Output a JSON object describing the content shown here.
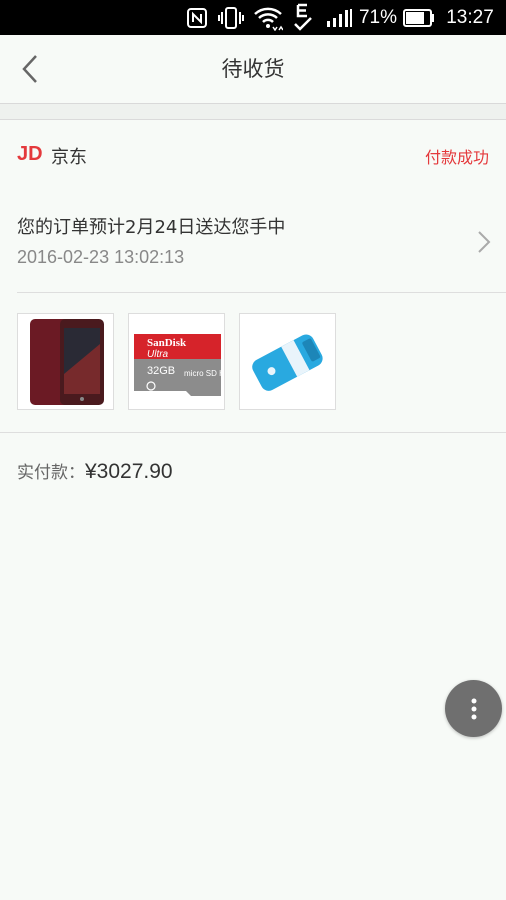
{
  "status_bar": {
    "battery_percent": "71%",
    "time": "13:27",
    "icons": [
      "nfc-icon",
      "vibrate-icon",
      "wifi-icon",
      "e-network-icon",
      "signal-icon",
      "battery-icon"
    ]
  },
  "header": {
    "title": "待收货",
    "back_icon": "chevron-left-icon"
  },
  "order": {
    "shop_logo": "JD",
    "shop_name": "京东",
    "status": "付款成功",
    "delivery_message": "您的订单预计2月24日送达您手中",
    "order_time": "2016-02-23 13:02:13",
    "products": [
      {
        "name": "phone",
        "icon": "phone-image"
      },
      {
        "name": "sd-card",
        "icon": "sd-card-image",
        "brand": "SanDisk",
        "line": "Ultra",
        "capacity": "32GB",
        "format": "micro SD HC I"
      },
      {
        "name": "card-reader",
        "icon": "card-reader-image"
      }
    ],
    "total_label": "实付款：",
    "total_amount": "¥3027.90"
  },
  "fab": {
    "icon": "more-vertical-icon"
  },
  "colors": {
    "accent": "#e4393c",
    "background": "#f7faf7",
    "status_bar": "#000000",
    "fab": "#6f6f6f"
  }
}
